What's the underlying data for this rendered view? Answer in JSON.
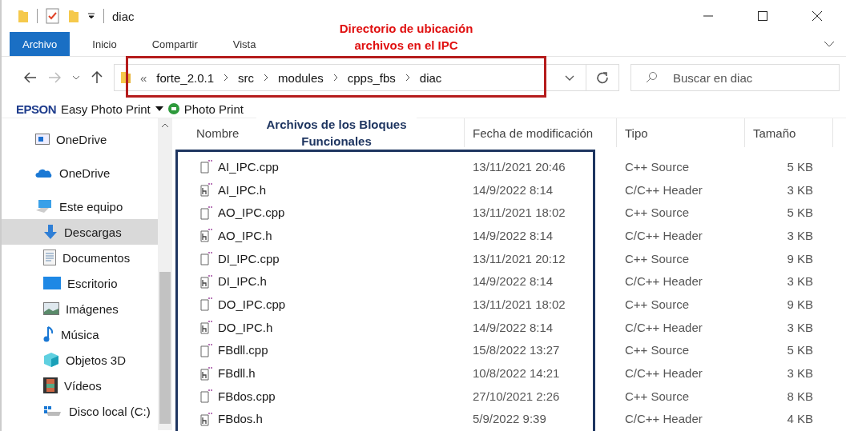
{
  "window": {
    "title": "diac"
  },
  "ribbon_tabs": [
    {
      "label": "Archivo",
      "selected": true
    },
    {
      "label": "Inicio",
      "selected": false
    },
    {
      "label": "Compartir",
      "selected": false
    },
    {
      "label": "Vista",
      "selected": false
    }
  ],
  "address_bar": {
    "overflow": "«",
    "path": [
      "forte_2.0.1",
      "src",
      "modules",
      "cpps_fbs",
      "diac"
    ]
  },
  "search": {
    "placeholder": "Buscar en diac"
  },
  "toolbar": {
    "brand": "EPSON",
    "easy_print": "Easy Photo Print",
    "photo_print": "Photo Print"
  },
  "sidebar": {
    "items": [
      {
        "label": "OneDrive",
        "kind": "onedrive-box",
        "selected": false
      },
      {
        "label": "OneDrive",
        "kind": "cloud",
        "selected": false
      },
      {
        "label": "Este equipo",
        "kind": "pc",
        "selected": false,
        "children": [
          {
            "label": "Descargas",
            "kind": "downloads",
            "selected": true
          },
          {
            "label": "Documentos",
            "kind": "documents",
            "selected": false
          },
          {
            "label": "Escritorio",
            "kind": "desktop",
            "selected": false
          },
          {
            "label": "Imágenes",
            "kind": "images",
            "selected": false
          },
          {
            "label": "Música",
            "kind": "music",
            "selected": false
          },
          {
            "label": "Objetos 3D",
            "kind": "objects3d",
            "selected": false
          },
          {
            "label": "Vídeos",
            "kind": "videos",
            "selected": false
          },
          {
            "label": "Disco local (C:)",
            "kind": "disk",
            "selected": false
          }
        ]
      }
    ]
  },
  "table": {
    "columns": [
      "Nombre",
      "Fecha de modificación",
      "Tipo",
      "Tamaño"
    ],
    "rows": [
      {
        "name": "AI_IPC.cpp",
        "kind": "cpp",
        "date": "13/11/2021 20:46",
        "type": "C++ Source",
        "size": "5 KB"
      },
      {
        "name": "AI_IPC.h",
        "kind": "h",
        "date": "14/9/2022 8:14",
        "type": "C/C++ Header",
        "size": "3 KB"
      },
      {
        "name": "AO_IPC.cpp",
        "kind": "cpp",
        "date": "13/11/2021 18:02",
        "type": "C++ Source",
        "size": "5 KB"
      },
      {
        "name": "AO_IPC.h",
        "kind": "h",
        "date": "14/9/2022 8:14",
        "type": "C/C++ Header",
        "size": "3 KB"
      },
      {
        "name": "DI_IPC.cpp",
        "kind": "cpp",
        "date": "13/11/2021 20:12",
        "type": "C++ Source",
        "size": "9 KB"
      },
      {
        "name": "DI_IPC.h",
        "kind": "h",
        "date": "14/9/2022 8:14",
        "type": "C/C++ Header",
        "size": "3 KB"
      },
      {
        "name": "DO_IPC.cpp",
        "kind": "cpp",
        "date": "13/11/2021 18:02",
        "type": "C++ Source",
        "size": "9 KB"
      },
      {
        "name": "DO_IPC.h",
        "kind": "h",
        "date": "14/9/2022 8:14",
        "type": "C/C++ Header",
        "size": "3 KB"
      },
      {
        "name": "FBdll.cpp",
        "kind": "cpp",
        "date": "15/8/2022 13:27",
        "type": "C++ Source",
        "size": "5 KB"
      },
      {
        "name": "FBdll.h",
        "kind": "h",
        "date": "10/8/2022 14:21",
        "type": "C/C++ Header",
        "size": "3 KB"
      },
      {
        "name": "FBdos.cpp",
        "kind": "cpp",
        "date": "27/10/2021 2:26",
        "type": "C++ Source",
        "size": "8 KB"
      },
      {
        "name": "FBdos.h",
        "kind": "h",
        "date": "5/9/2022 9:39",
        "type": "C/C++ Header",
        "size": "4 KB"
      }
    ]
  },
  "annotations": [
    {
      "text": "Directorio de ubicación archivos en el IPC",
      "kind": "address"
    },
    {
      "text": "Archivos de los Bloques Funcionales",
      "kind": "files"
    }
  ]
}
